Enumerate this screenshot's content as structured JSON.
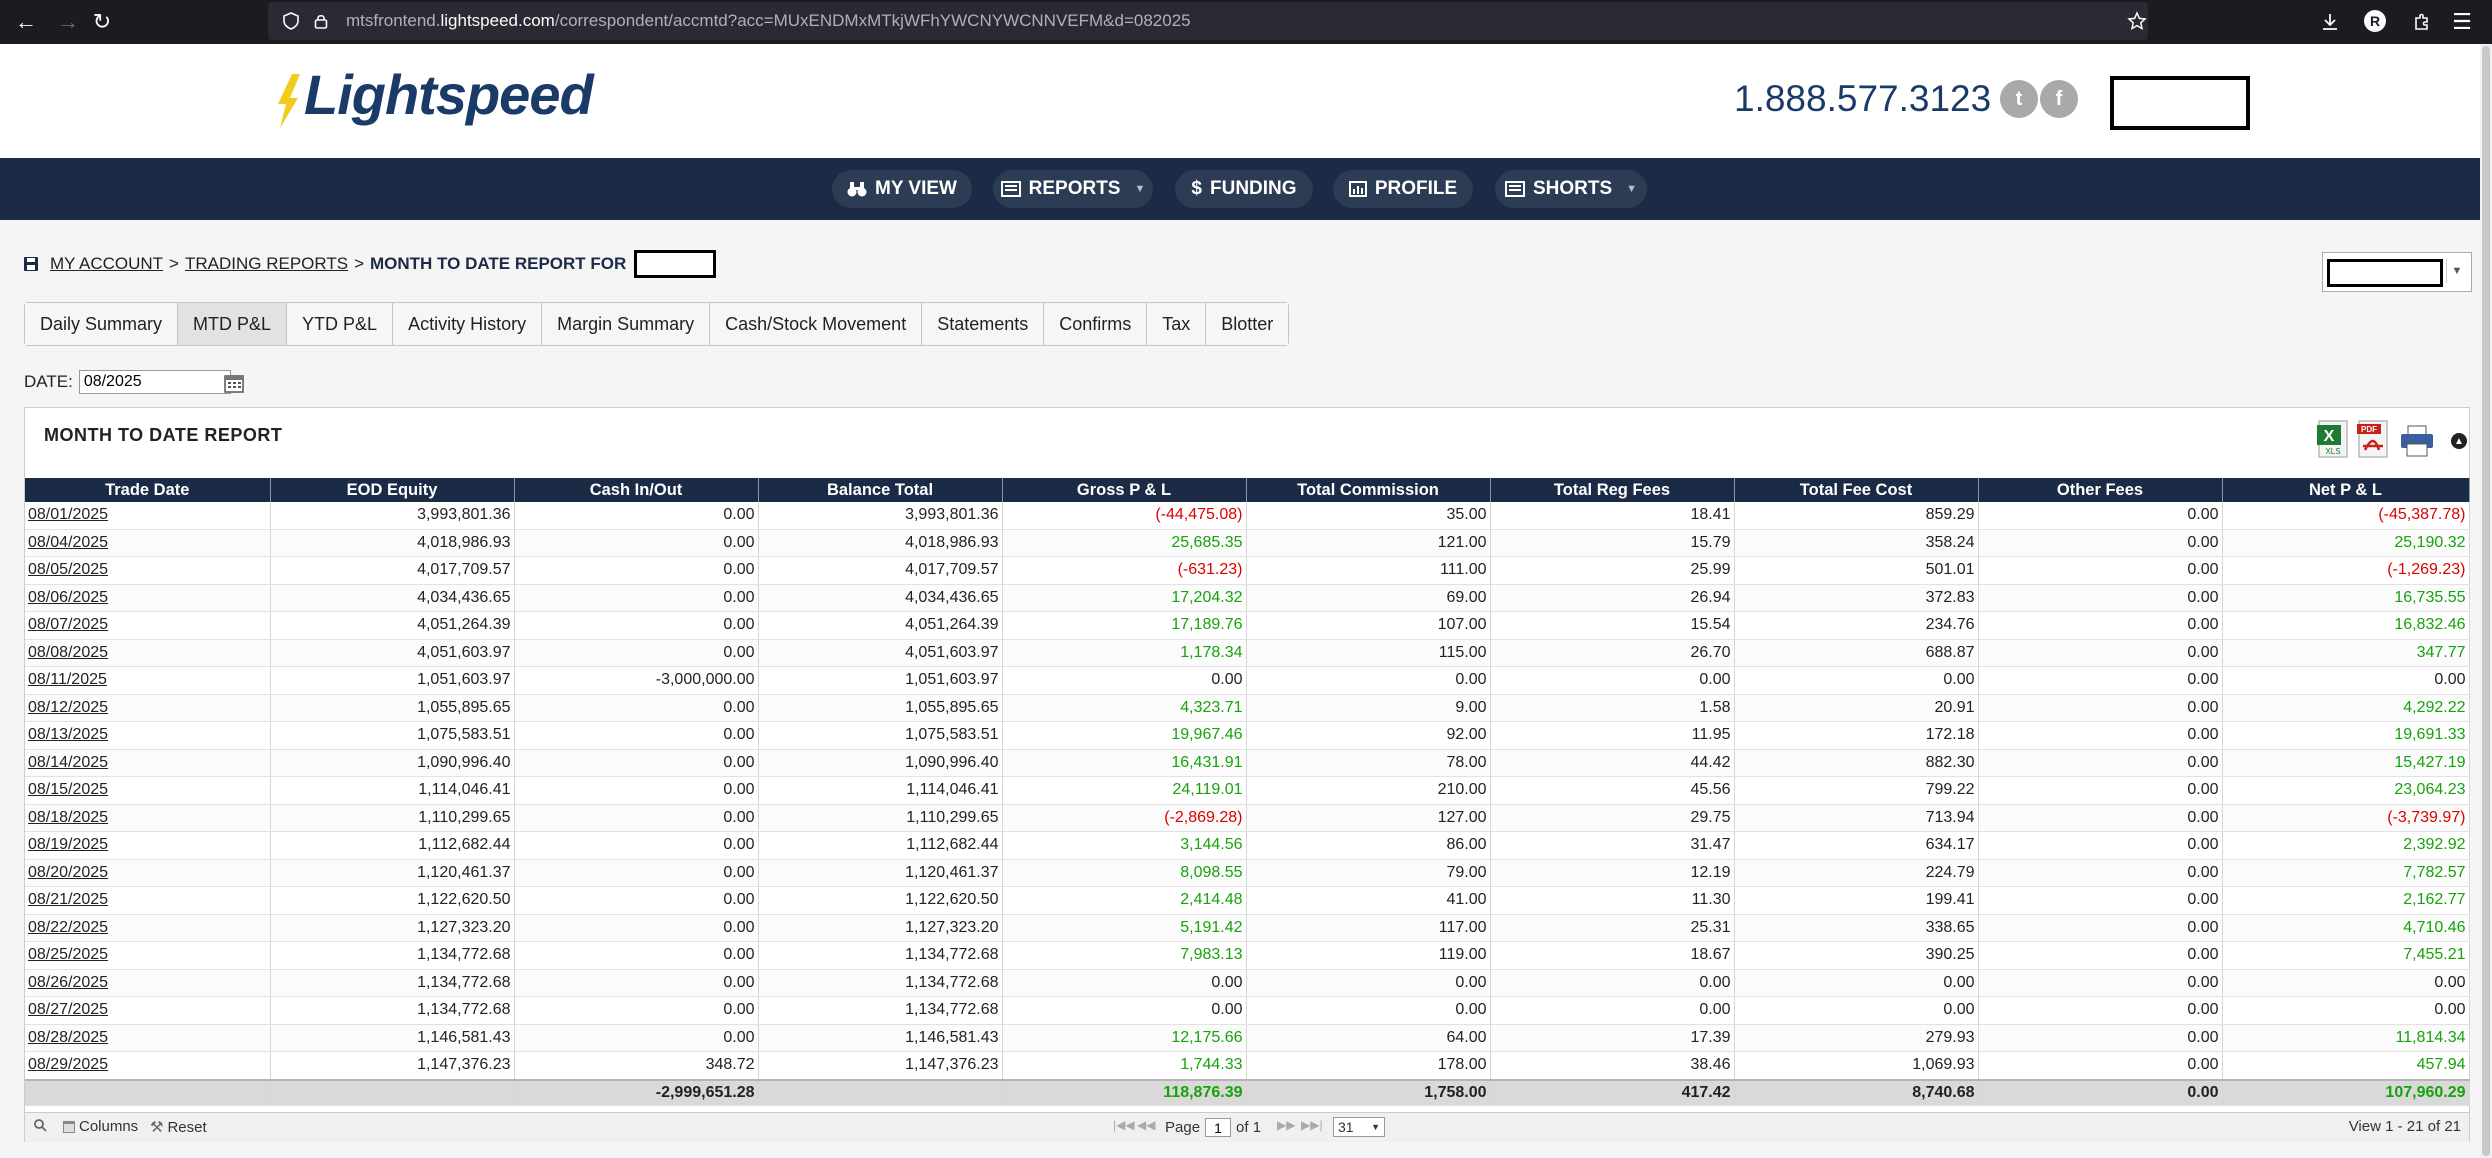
{
  "browser": {
    "url_prefix": "mtsfrontend.",
    "url_domain": "lightspeed.com",
    "url_path": "/correspondent/accmtd?acc=MUxENDMxMTkjWFhYWCNYWCNNVEFM&d=082025",
    "profile_initial": "R"
  },
  "header": {
    "logo_text": "Lightspeed",
    "phone": "1.888.577.3123",
    "twitter_glyph": "t",
    "facebook_glyph": "f"
  },
  "nav": {
    "items": [
      {
        "label": "MY VIEW",
        "icon": "binoculars-icon"
      },
      {
        "label": "REPORTS",
        "icon": "report-icon"
      },
      {
        "label": "FUNDING",
        "icon": "dollar-icon"
      },
      {
        "label": "PROFILE",
        "icon": "bar-chart-icon"
      },
      {
        "label": "SHORTS",
        "icon": "list-icon"
      }
    ]
  },
  "breadcrumb": {
    "my_account": "MY ACCOUNT",
    "trading_reports": "TRADING REPORTS",
    "current": "MONTH TO DATE REPORT FOR",
    "sep": ">"
  },
  "tabs": [
    {
      "label": "Daily Summary",
      "active": false
    },
    {
      "label": "MTD P&L",
      "active": true
    },
    {
      "label": "YTD P&L",
      "active": false
    },
    {
      "label": "Activity History",
      "active": false
    },
    {
      "label": "Margin Summary",
      "active": false
    },
    {
      "label": "Cash/Stock Movement",
      "active": false
    },
    {
      "label": "Statements",
      "active": false
    },
    {
      "label": "Confirms",
      "active": false
    },
    {
      "label": "Tax",
      "active": false
    },
    {
      "label": "Blotter",
      "active": false
    }
  ],
  "date_filter": {
    "label": "DATE:",
    "value": "08/2025"
  },
  "report": {
    "title": "MONTH TO DATE REPORT",
    "columns": [
      "Trade Date",
      "EOD Equity",
      "Cash In/Out",
      "Balance Total",
      "Gross P & L",
      "Total Commission",
      "Total Reg Fees",
      "Total Fee Cost",
      "Other Fees",
      "Net P & L"
    ],
    "rows": [
      [
        "08/01/2025",
        "3,993,801.36",
        "0.00",
        "3,993,801.36",
        "(-44,475.08)",
        "35.00",
        "18.41",
        "859.29",
        "0.00",
        "(-45,387.78)"
      ],
      [
        "08/04/2025",
        "4,018,986.93",
        "0.00",
        "4,018,986.93",
        "25,685.35",
        "121.00",
        "15.79",
        "358.24",
        "0.00",
        "25,190.32"
      ],
      [
        "08/05/2025",
        "4,017,709.57",
        "0.00",
        "4,017,709.57",
        "(-631.23)",
        "111.00",
        "25.99",
        "501.01",
        "0.00",
        "(-1,269.23)"
      ],
      [
        "08/06/2025",
        "4,034,436.65",
        "0.00",
        "4,034,436.65",
        "17,204.32",
        "69.00",
        "26.94",
        "372.83",
        "0.00",
        "16,735.55"
      ],
      [
        "08/07/2025",
        "4,051,264.39",
        "0.00",
        "4,051,264.39",
        "17,189.76",
        "107.00",
        "15.54",
        "234.76",
        "0.00",
        "16,832.46"
      ],
      [
        "08/08/2025",
        "4,051,603.97",
        "0.00",
        "4,051,603.97",
        "1,178.34",
        "115.00",
        "26.70",
        "688.87",
        "0.00",
        "347.77"
      ],
      [
        "08/11/2025",
        "1,051,603.97",
        "-3,000,000.00",
        "1,051,603.97",
        "0.00",
        "0.00",
        "0.00",
        "0.00",
        "0.00",
        "0.00"
      ],
      [
        "08/12/2025",
        "1,055,895.65",
        "0.00",
        "1,055,895.65",
        "4,323.71",
        "9.00",
        "1.58",
        "20.91",
        "0.00",
        "4,292.22"
      ],
      [
        "08/13/2025",
        "1,075,583.51",
        "0.00",
        "1,075,583.51",
        "19,967.46",
        "92.00",
        "11.95",
        "172.18",
        "0.00",
        "19,691.33"
      ],
      [
        "08/14/2025",
        "1,090,996.40",
        "0.00",
        "1,090,996.40",
        "16,431.91",
        "78.00",
        "44.42",
        "882.30",
        "0.00",
        "15,427.19"
      ],
      [
        "08/15/2025",
        "1,114,046.41",
        "0.00",
        "1,114,046.41",
        "24,119.01",
        "210.00",
        "45.56",
        "799.22",
        "0.00",
        "23,064.23"
      ],
      [
        "08/18/2025",
        "1,110,299.65",
        "0.00",
        "1,110,299.65",
        "(-2,869.28)",
        "127.00",
        "29.75",
        "713.94",
        "0.00",
        "(-3,739.97)"
      ],
      [
        "08/19/2025",
        "1,112,682.44",
        "0.00",
        "1,112,682.44",
        "3,144.56",
        "86.00",
        "31.47",
        "634.17",
        "0.00",
        "2,392.92"
      ],
      [
        "08/20/2025",
        "1,120,461.37",
        "0.00",
        "1,120,461.37",
        "8,098.55",
        "79.00",
        "12.19",
        "224.79",
        "0.00",
        "7,782.57"
      ],
      [
        "08/21/2025",
        "1,122,620.50",
        "0.00",
        "1,122,620.50",
        "2,414.48",
        "41.00",
        "11.30",
        "199.41",
        "0.00",
        "2,162.77"
      ],
      [
        "08/22/2025",
        "1,127,323.20",
        "0.00",
        "1,127,323.20",
        "5,191.42",
        "117.00",
        "25.31",
        "338.65",
        "0.00",
        "4,710.46"
      ],
      [
        "08/25/2025",
        "1,134,772.68",
        "0.00",
        "1,134,772.68",
        "7,983.13",
        "119.00",
        "18.67",
        "390.25",
        "0.00",
        "7,455.21"
      ],
      [
        "08/26/2025",
        "1,134,772.68",
        "0.00",
        "1,134,772.68",
        "0.00",
        "0.00",
        "0.00",
        "0.00",
        "0.00",
        "0.00"
      ],
      [
        "08/27/2025",
        "1,134,772.68",
        "0.00",
        "1,134,772.68",
        "0.00",
        "0.00",
        "0.00",
        "0.00",
        "0.00",
        "0.00"
      ],
      [
        "08/28/2025",
        "1,146,581.43",
        "0.00",
        "1,146,581.43",
        "12,175.66",
        "64.00",
        "17.39",
        "279.93",
        "0.00",
        "11,814.34"
      ],
      [
        "08/29/2025",
        "1,147,376.23",
        "348.72",
        "1,147,376.23",
        "1,744.33",
        "178.00",
        "38.46",
        "1,069.93",
        "0.00",
        "457.94"
      ]
    ],
    "totals": [
      "",
      "",
      "-2,999,651.28",
      "",
      "118,876.39",
      "1,758.00",
      "417.42",
      "8,740.68",
      "0.00",
      "107,960.29"
    ]
  },
  "pager": {
    "columns_label": "Columns",
    "reset_label": "Reset",
    "page_label": "Page",
    "page_value": "1",
    "of_label": "of 1",
    "rows_per_page": "31",
    "view_text": "View 1 - 21 of 21"
  },
  "colors": {
    "nav_bg": "#1b2b45",
    "positive": "#16a30b",
    "negative": "#dd0000",
    "brand": "#1a3a68"
  }
}
